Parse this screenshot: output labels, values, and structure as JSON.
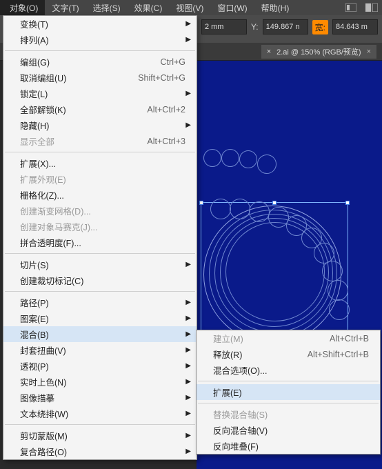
{
  "menubar": {
    "items": [
      "对象(O)",
      "文字(T)",
      "选择(S)",
      "效果(C)",
      "视图(V)",
      "窗口(W)",
      "帮助(H)"
    ]
  },
  "options": {
    "field1_suffix": "2 mm",
    "y_label": "Y:",
    "y_value": "149.867 n",
    "w_label": "宽:",
    "w_value": "84.643 m"
  },
  "tab": {
    "close_icon": "×",
    "label": "2.ai @ 150% (RGB/预览)",
    "close": "×"
  },
  "menu": {
    "transform": "变换(T)",
    "arrange": "排列(A)",
    "group": "编组(G)",
    "group_sc": "Ctrl+G",
    "ungroup": "取消编组(U)",
    "ungroup_sc": "Shift+Ctrl+G",
    "lock": "锁定(L)",
    "unlockAll": "全部解锁(K)",
    "unlockAll_sc": "Alt+Ctrl+2",
    "hide": "隐藏(H)",
    "showAll": "显示全部",
    "showAll_sc": "Alt+Ctrl+3",
    "expand": "扩展(X)...",
    "expandAppearance": "扩展外观(E)",
    "rasterize": "栅格化(Z)...",
    "gradientMesh": "创建渐变网格(D)...",
    "mosaic": "创建对象马赛克(J)...",
    "flatten": "拼合透明度(F)...",
    "slice": "切片(S)",
    "trim": "创建裁切标记(C)",
    "path": "路径(P)",
    "pattern": "图案(E)",
    "blend": "混合(B)",
    "envelope": "封套扭曲(V)",
    "perspective": "透视(P)",
    "livePaint": "实时上色(N)",
    "imageTrace": "图像描摹",
    "textWrap": "文本绕排(W)",
    "clipMask": "剪切蒙版(M)",
    "compound": "复合路径(O)"
  },
  "submenu": {
    "make": "建立(M)",
    "make_sc": "Alt+Ctrl+B",
    "release": "释放(R)",
    "release_sc": "Alt+Shift+Ctrl+B",
    "options": "混合选项(O)...",
    "expand": "扩展(E)",
    "replaceSpine": "替换混合轴(S)",
    "reverseSpine": "反向混合轴(V)",
    "reverseFront": "反向堆叠(F)"
  }
}
